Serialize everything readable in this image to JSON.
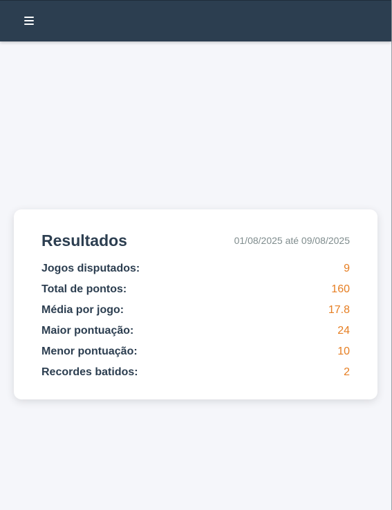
{
  "header": {
    "menu_icon": "hamburger-menu-icon"
  },
  "results": {
    "title": "Resultados",
    "date_range": "01/08/2025 até 09/08/2025",
    "stats": [
      {
        "label": "Jogos disputados:",
        "value": "9"
      },
      {
        "label": "Total de pontos:",
        "value": "160"
      },
      {
        "label": "Média por jogo:",
        "value": "17.8"
      },
      {
        "label": "Maior pontuação:",
        "value": "24"
      },
      {
        "label": "Menor pontuação:",
        "value": "10"
      },
      {
        "label": "Recordes batidos:",
        "value": "2"
      }
    ]
  },
  "colors": {
    "header_bg": "#2c3e50",
    "page_bg": "#f5f6fa",
    "accent_value": "#e67e22",
    "label_text": "#2c3e50",
    "muted_text": "#7f8c8d"
  }
}
